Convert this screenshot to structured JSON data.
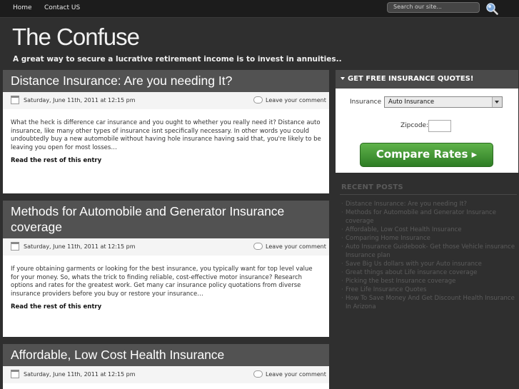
{
  "nav": {
    "home": "Home",
    "contact": "Contact US"
  },
  "search": {
    "placeholder": "Search our site..."
  },
  "site": {
    "title": "The Confuse",
    "tagline": "A great way to secure a lucrative retirement income is to invest in annuities.."
  },
  "posts": [
    {
      "title": "Distance Insurance: Are you needing It?",
      "date": "Saturday, June 11th, 2011 at 12:15 pm",
      "comment": "Leave your comment",
      "excerpt": "What the heck is difference car insurance and you ought to whether you really need it? Distance auto insurance, like many other types of insurance isnt specifically necessary. In other words you could undoubtedly buy a new automobile without having hole insurance having said that, you're likely to be leaving you open for most losses…",
      "read_more": "Read the rest of this entry"
    },
    {
      "title": "Methods for Automobile and Generator Insurance coverage",
      "date": "Saturday, June 11th, 2011 at 12:15 pm",
      "comment": "Leave your comment",
      "excerpt": "If youre obtaining garments or looking for the best insurance, you typically want for top level value for your money. So, whats the trick to finding reliable, cost-effective motor insurance? Research options and rates for the greatest work. Get many car insurance policy quotations from diverse insurance providers before you buy or restore your insurance…",
      "read_more": "Read the rest of this entry"
    },
    {
      "title": "Affordable, Low Cost Health Insurance",
      "date": "Saturday, June 11th, 2011 at 12:15 pm",
      "comment": "Leave your comment"
    }
  ],
  "quote": {
    "header": "GET FREE INSURANCE QUOTES!",
    "insurance_label": "Insurance :",
    "insurance_value": "Auto Insurance",
    "zipcode_label": "Zipcode:",
    "button": "Compare Rates ▸"
  },
  "recent": {
    "title": "RECENT POSTS",
    "items": [
      "Distance Insurance: Are you needing It?",
      "Methods for Automobile and Generator Insurance coverage",
      "Affordable, Low Cost Health Insurance",
      "Comparing Home Insurance",
      "Auto Insurance Guidebook- Get those Vehicle insurance Insurance plan",
      "Save Big Us dollars with your Auto insurance",
      "Great things about Life insurance coverage",
      "Picking the best Insurance coverage",
      "Free Life Insurance Quotes",
      "How To Save Money And Get Discount Health Insurance In Arizona"
    ]
  }
}
